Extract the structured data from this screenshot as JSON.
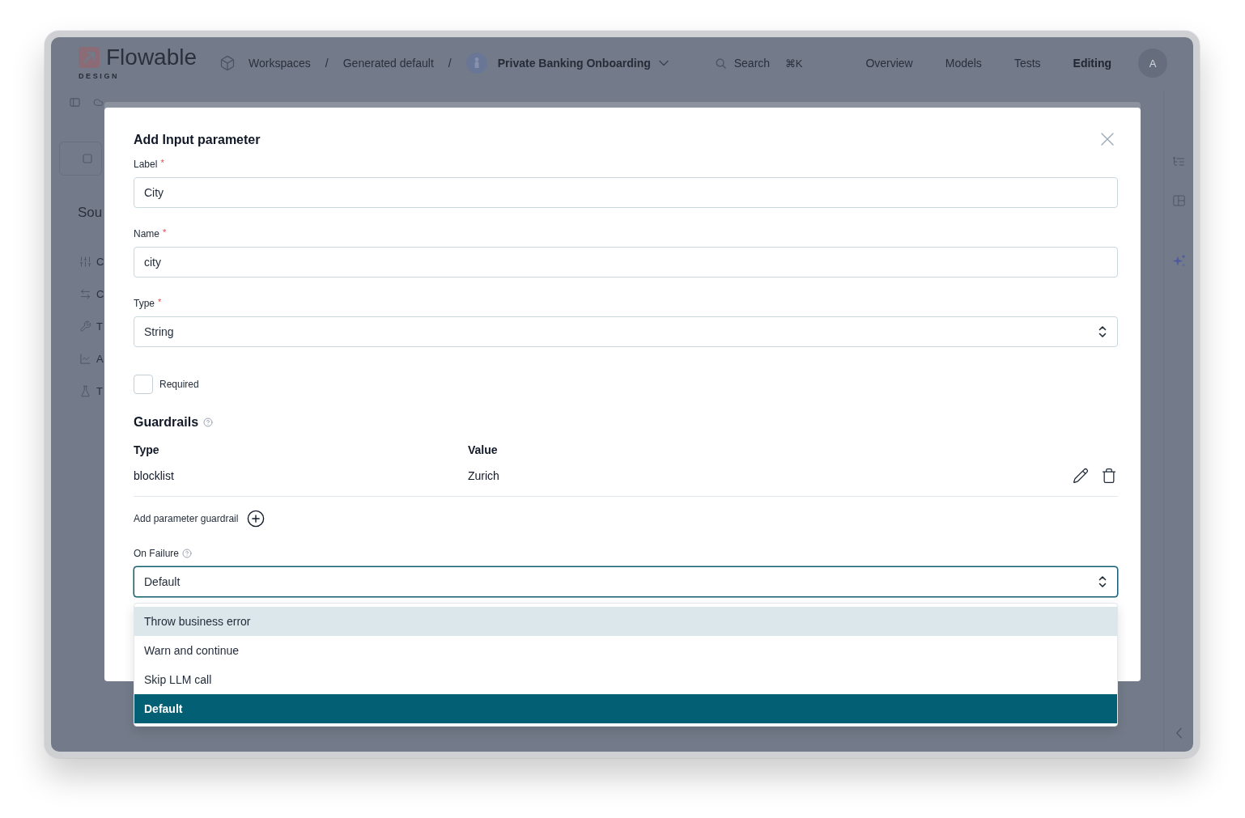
{
  "app_header": {
    "logo": {
      "wordmark": "Flowable",
      "subtitle": "DESIGN"
    },
    "breadcrumbs": [
      {
        "kind": "workspace",
        "label": "Workspaces"
      },
      {
        "kind": "plain",
        "separator": "/",
        "label": "Generated default"
      },
      {
        "kind": "project",
        "separator": "/",
        "label": "Private Banking Onboarding"
      }
    ],
    "search": {
      "placeholder": "Search",
      "shortcut": "⌘K"
    },
    "nav": [
      {
        "label": "Overview",
        "selected": false
      },
      {
        "label": "Models",
        "selected": false
      },
      {
        "label": "Tests",
        "selected": false
      },
      {
        "label": "Editing",
        "selected": true
      }
    ],
    "user_avatar": {
      "initial": "A"
    }
  },
  "side_panel": {
    "heading": "Sou",
    "items": [
      {
        "kind": "sliders",
        "label": "C"
      },
      {
        "kind": "arrows",
        "label": "C"
      },
      {
        "kind": "wrench",
        "label": "T"
      },
      {
        "kind": "chart",
        "label": "A"
      },
      {
        "kind": "flask",
        "label": "T"
      }
    ]
  },
  "dialog": {
    "title": "Add Input parameter",
    "fields": [
      {
        "kind": "text",
        "label": "Label",
        "required_mark": "*",
        "value": "City"
      },
      {
        "kind": "text",
        "label": "Name",
        "required_mark": "*",
        "value": "city"
      },
      {
        "kind": "select",
        "label": "Type",
        "required_mark": "*",
        "value": "String"
      }
    ],
    "required_checkbox": {
      "label": "Required",
      "checked": false
    },
    "guardrails": {
      "title": "Guardrails",
      "columns": [
        "Type",
        "Value"
      ],
      "rows": [
        {
          "cells": [
            "blocklist",
            "Zurich"
          ]
        }
      ],
      "add_label": "Add parameter guardrail"
    },
    "on_failure": {
      "label": "On Failure",
      "value": "Default",
      "focused": true,
      "expanded": true,
      "options": [
        {
          "label": "Throw business error",
          "highlighted": true,
          "selected": false
        },
        {
          "label": "Warn and continue",
          "highlighted": false,
          "selected": false
        },
        {
          "label": "Skip LLM call",
          "highlighted": false,
          "selected": false
        },
        {
          "label": "Default",
          "highlighted": false,
          "selected": true
        }
      ]
    }
  }
}
